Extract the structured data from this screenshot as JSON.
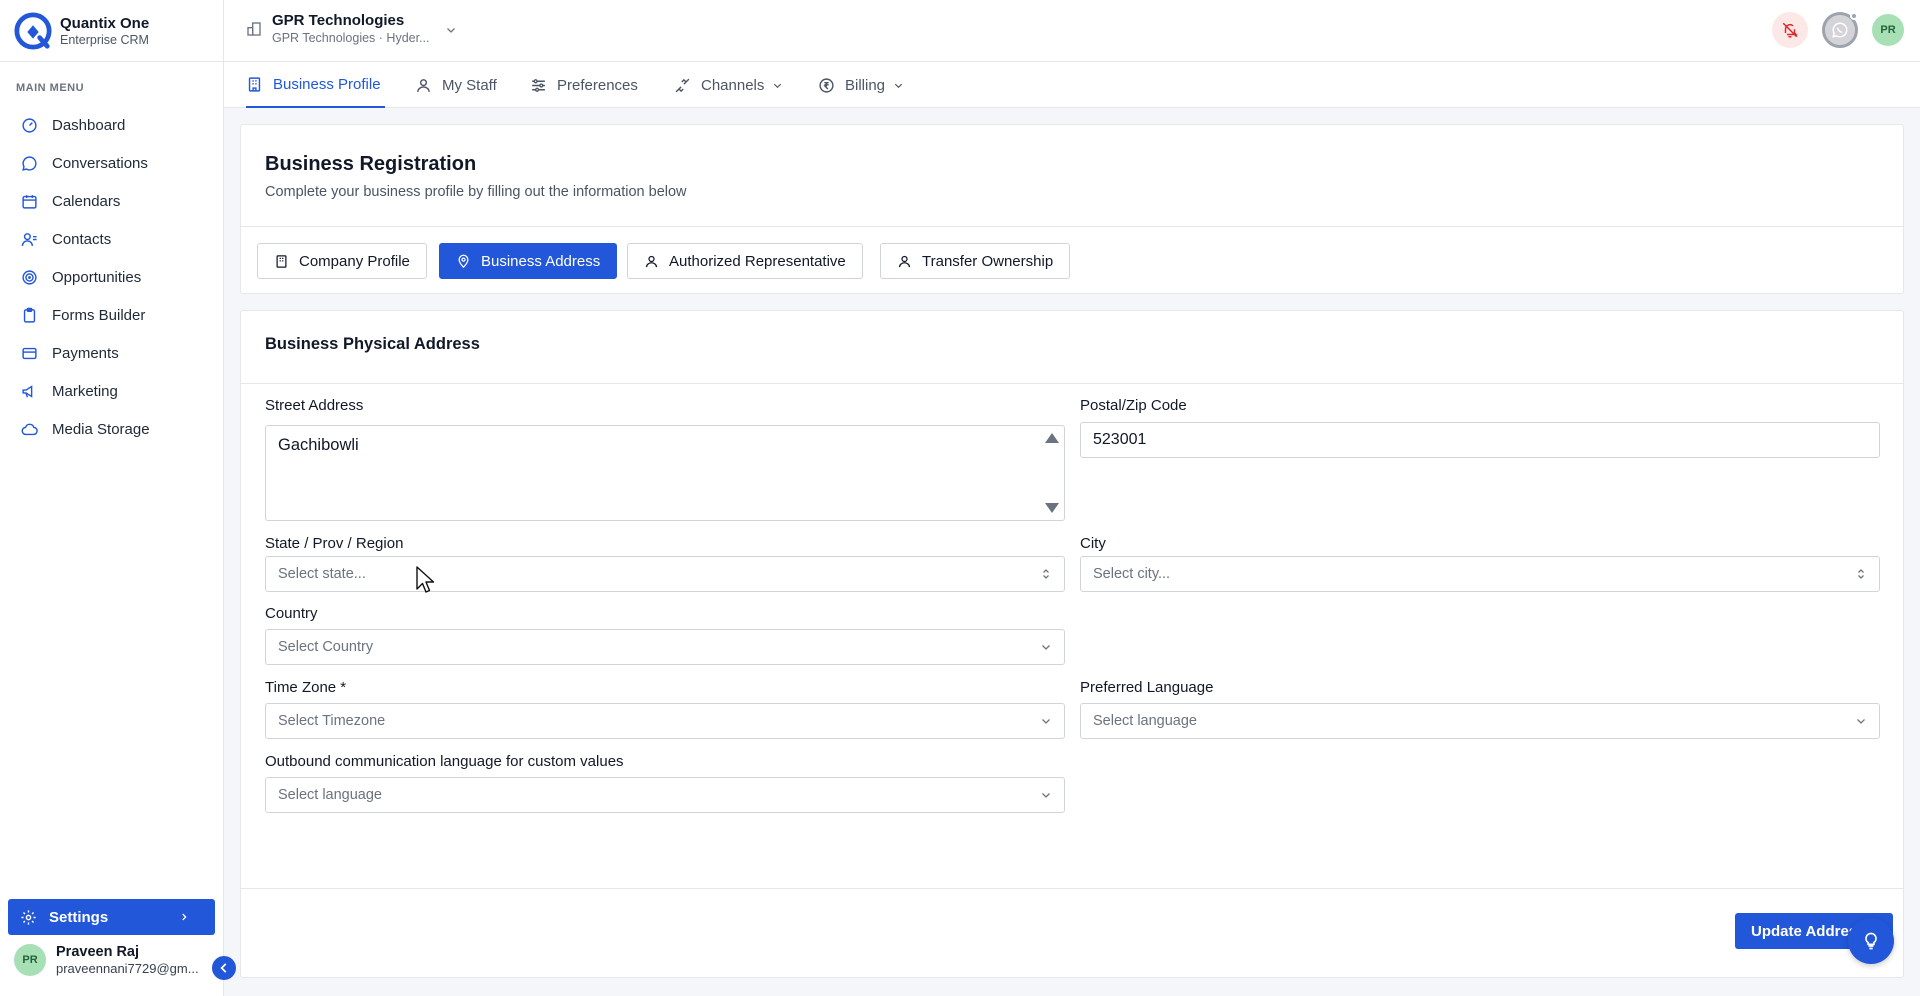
{
  "brand": {
    "name": "Quantix One",
    "subtitle": "Enterprise CRM"
  },
  "sidebar": {
    "menu_label": "MAIN MENU",
    "items": [
      {
        "label": "Dashboard",
        "icon": "dashboard-icon"
      },
      {
        "label": "Conversations",
        "icon": "chat-icon"
      },
      {
        "label": "Calendars",
        "icon": "calendar-icon"
      },
      {
        "label": "Contacts",
        "icon": "contacts-icon"
      },
      {
        "label": "Opportunities",
        "icon": "target-icon"
      },
      {
        "label": "Forms Builder",
        "icon": "clipboard-icon"
      },
      {
        "label": "Payments",
        "icon": "card-icon"
      },
      {
        "label": "Marketing",
        "icon": "megaphone-icon"
      },
      {
        "label": "Media Storage",
        "icon": "cloud-icon"
      }
    ],
    "settings_label": "Settings",
    "user": {
      "initials": "PR",
      "name": "Praveen Raj",
      "email": "praveennani7729@gm..."
    }
  },
  "topbar": {
    "org_name": "GPR Technologies",
    "org_sub": "GPR Technologies · Hyder...",
    "avatar_initials": "PR"
  },
  "tabs": [
    {
      "label": "Business Profile",
      "active": true
    },
    {
      "label": "My Staff"
    },
    {
      "label": "Preferences"
    },
    {
      "label": "Channels",
      "dropdown": true
    },
    {
      "label": "Billing",
      "dropdown": true
    }
  ],
  "registration": {
    "title": "Business Registration",
    "subtitle": "Complete your business profile by filling out the information below",
    "subtabs": [
      {
        "label": "Company Profile"
      },
      {
        "label": "Business Address",
        "active": true
      },
      {
        "label": "Authorized Representative"
      },
      {
        "label": "Transfer Ownership"
      }
    ]
  },
  "address": {
    "title": "Business Physical Address",
    "street": {
      "label": "Street Address",
      "value": "Gachibowli"
    },
    "postal": {
      "label": "Postal/Zip Code",
      "value": "523001"
    },
    "state": {
      "label": "State / Prov / Region",
      "placeholder": "Select state..."
    },
    "city": {
      "label": "City",
      "placeholder": "Select city..."
    },
    "country": {
      "label": "Country",
      "placeholder": "Select Country"
    },
    "timezone": {
      "label": "Time Zone *",
      "placeholder": "Select Timezone"
    },
    "preferred_language": {
      "label": "Preferred Language",
      "placeholder": "Select language"
    },
    "outbound_language": {
      "label": "Outbound communication language for custom values",
      "placeholder": "Select language"
    },
    "update_label": "Update Address"
  },
  "colors": {
    "accent": "#2157d8",
    "text": "#111827",
    "muted": "#6b7280",
    "border": "#e5e7eb"
  }
}
